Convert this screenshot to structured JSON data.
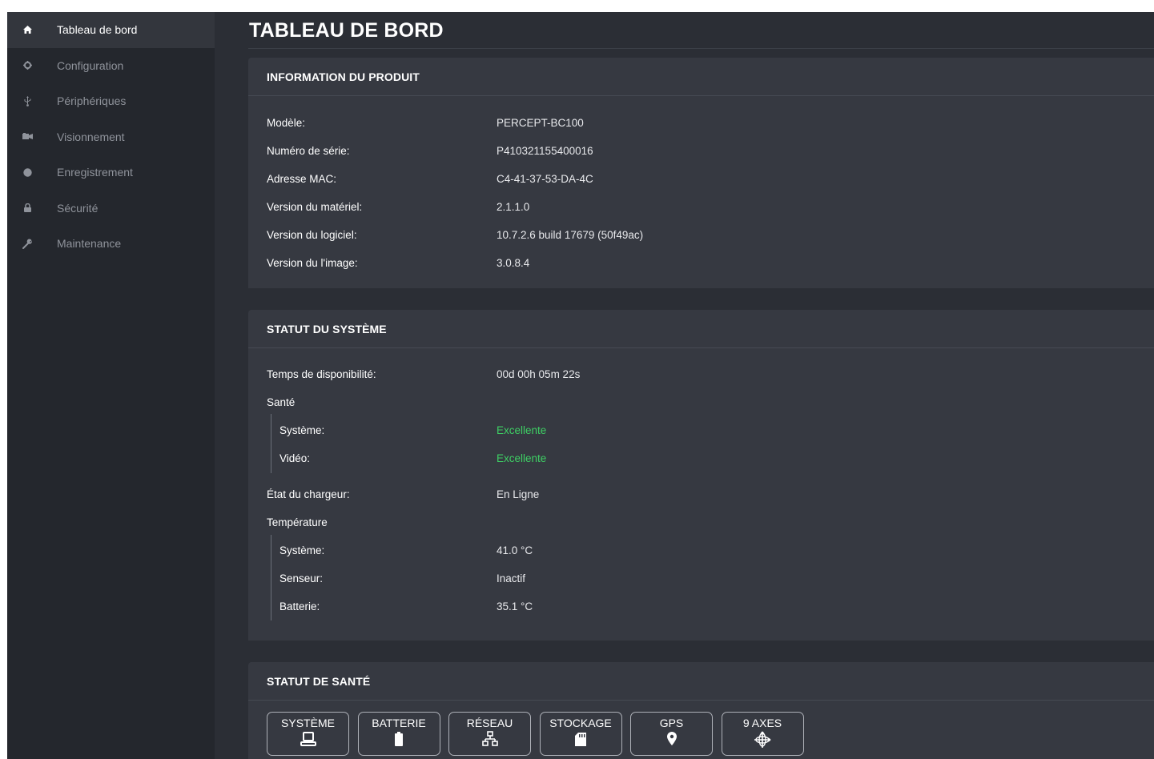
{
  "sidebar": {
    "items": [
      {
        "label": "Tableau de bord",
        "icon": "home-icon",
        "active": true
      },
      {
        "label": "Configuration",
        "icon": "gear-icon",
        "active": false
      },
      {
        "label": "Périphériques",
        "icon": "usb-icon",
        "active": false
      },
      {
        "label": "Visionnement",
        "icon": "camera-icon",
        "active": false
      },
      {
        "label": "Enregistrement",
        "icon": "record-icon",
        "active": false
      },
      {
        "label": "Sécurité",
        "icon": "lock-icon",
        "active": false
      },
      {
        "label": "Maintenance",
        "icon": "wrench-icon",
        "active": false
      }
    ]
  },
  "page": {
    "title": "TABLEAU DE BORD"
  },
  "product_info": {
    "header": "INFORMATION DU PRODUIT",
    "rows": [
      {
        "label": "Modèle:",
        "value": "PERCEPT-BC100"
      },
      {
        "label": "Numéro de série:",
        "value": "P410321155400016"
      },
      {
        "label": "Adresse MAC:",
        "value": "C4-41-37-53-DA-4C"
      },
      {
        "label": "Version du matériel:",
        "value": "2.1.1.0"
      },
      {
        "label": "Version du logiciel:",
        "value": "10.7.2.6 build 17679 (50f49ac)"
      },
      {
        "label": "Version du l'image:",
        "value": "3.0.8.4"
      }
    ]
  },
  "system_status": {
    "header": "STATUT DU SYSTÈME",
    "uptime": {
      "label": "Temps de disponibilité:",
      "value": "00d 00h 05m 22s"
    },
    "health": {
      "label": "Santé",
      "system": {
        "label": "Système:",
        "value": "Excellente"
      },
      "video": {
        "label": "Vidéo:",
        "value": "Excellente"
      }
    },
    "charger": {
      "label": "État du chargeur:",
      "value": "En Ligne"
    },
    "temperature": {
      "label": "Température",
      "system": {
        "label": "Système:",
        "value": "41.0 °C"
      },
      "sensor": {
        "label": "Senseur:",
        "value": "Inactif"
      },
      "battery": {
        "label": "Batterie:",
        "value": "35.1 °C"
      }
    }
  },
  "health_status": {
    "header": "STATUT DE SANTÉ",
    "buttons": [
      {
        "label": "SYSTÈME",
        "icon": "laptop-icon"
      },
      {
        "label": "BATTERIE",
        "icon": "battery-icon"
      },
      {
        "label": "RÉSEAU",
        "icon": "network-icon"
      },
      {
        "label": "STOCKAGE",
        "icon": "sd-card-icon"
      },
      {
        "label": "GPS",
        "icon": "map-pin-icon"
      },
      {
        "label": "9 AXES",
        "icon": "axes-icon"
      }
    ]
  },
  "colors": {
    "good": "#3ecf64",
    "sidebar_bg": "#24272d",
    "panel_bg": "#363941",
    "page_bg": "#2b2e35"
  }
}
